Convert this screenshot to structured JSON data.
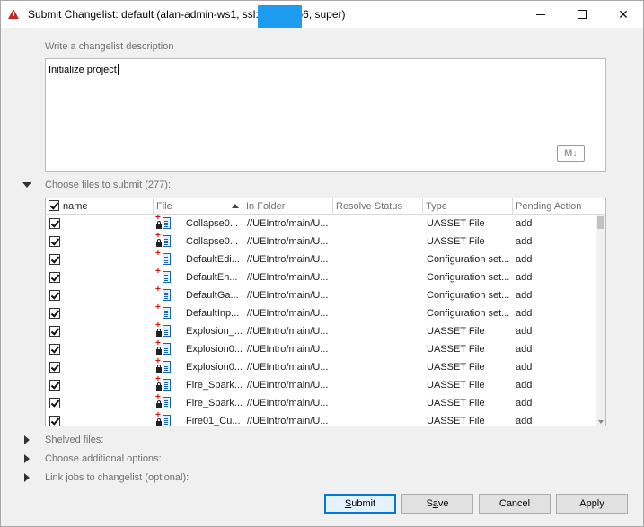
{
  "window": {
    "title": "Submit Changelist: default (alan-admin-ws1,  ssl:            com:1666,  super)",
    "controls": {
      "minimize": "minimize",
      "maximize": "maximize",
      "close": "✕"
    }
  },
  "description": {
    "label": "Write a changelist description",
    "value": "Initialize project",
    "markdown_badge": "M↓"
  },
  "files_section": {
    "label": "Choose files to submit (277):",
    "columns": [
      "name",
      "File",
      "In Folder",
      "Resolve Status",
      "Type",
      "Pending Action"
    ],
    "rows": [
      {
        "file": "Collapse0...",
        "folder": "//UEIntro/main/U...",
        "resolve": "",
        "type": "UASSET File",
        "action": "add",
        "locked": true
      },
      {
        "file": "Collapse0...",
        "folder": "//UEIntro/main/U...",
        "resolve": "",
        "type": "UASSET File",
        "action": "add",
        "locked": true
      },
      {
        "file": "DefaultEdi...",
        "folder": "//UEIntro/main/U...",
        "resolve": "",
        "type": "Configuration set...",
        "action": "add",
        "locked": false
      },
      {
        "file": "DefaultEn...",
        "folder": "//UEIntro/main/U...",
        "resolve": "",
        "type": "Configuration set...",
        "action": "add",
        "locked": false
      },
      {
        "file": "DefaultGa...",
        "folder": "//UEIntro/main/U...",
        "resolve": "",
        "type": "Configuration set...",
        "action": "add",
        "locked": false
      },
      {
        "file": "DefaultInp...",
        "folder": "//UEIntro/main/U...",
        "resolve": "",
        "type": "Configuration set...",
        "action": "add",
        "locked": false
      },
      {
        "file": "Explosion_...",
        "folder": "//UEIntro/main/U...",
        "resolve": "",
        "type": "UASSET File",
        "action": "add",
        "locked": true
      },
      {
        "file": "Explosion0...",
        "folder": "//UEIntro/main/U...",
        "resolve": "",
        "type": "UASSET File",
        "action": "add",
        "locked": true
      },
      {
        "file": "Explosion0...",
        "folder": "//UEIntro/main/U...",
        "resolve": "",
        "type": "UASSET File",
        "action": "add",
        "locked": true
      },
      {
        "file": "Fire_Spark...",
        "folder": "//UEIntro/main/U...",
        "resolve": "",
        "type": "UASSET File",
        "action": "add",
        "locked": true
      },
      {
        "file": "Fire_Spark...",
        "folder": "//UEIntro/main/U...",
        "resolve": "",
        "type": "UASSET File",
        "action": "add",
        "locked": true
      },
      {
        "file": "Fire01_Cu...",
        "folder": "//UEIntro/main/U...",
        "resolve": "",
        "type": "UASSET File",
        "action": "add",
        "locked": true
      }
    ]
  },
  "collapsed_sections": [
    {
      "label": "Shelved files:"
    },
    {
      "label": "Choose additional options:"
    },
    {
      "label": "Link jobs to changelist (optional):"
    }
  ],
  "buttons": {
    "submit": "Submit",
    "save": "Save",
    "cancel": "Cancel",
    "apply": "Apply"
  }
}
